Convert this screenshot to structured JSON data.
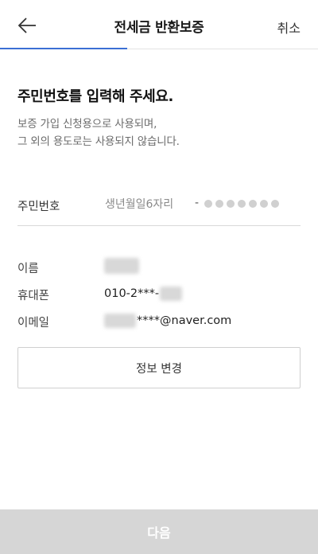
{
  "header": {
    "title": "전세금 반환보증",
    "cancel_label": "취소",
    "back_icon": "arrow-left-icon",
    "progress": 0.4
  },
  "main": {
    "heading": "주민번호를 입력해 주세요.",
    "description_line1": "보증 가입 신청용으로 사용되며,",
    "description_line2": "그 외의 용도로는 사용되지 않습니다."
  },
  "rrn": {
    "label": "주민번호",
    "placeholder": "생년월일6자리",
    "separator": "-",
    "masked_digits": 7
  },
  "info": {
    "name_label": "이름",
    "phone_label": "휴대폰",
    "phone_value": "010-2***-",
    "email_label": "이메일",
    "email_value": "****@naver.com"
  },
  "buttons": {
    "change_info": "정보 변경",
    "next": "다음"
  },
  "colors": {
    "accent": "#3b6fd4",
    "disabled_button": "#d6d6d6"
  }
}
